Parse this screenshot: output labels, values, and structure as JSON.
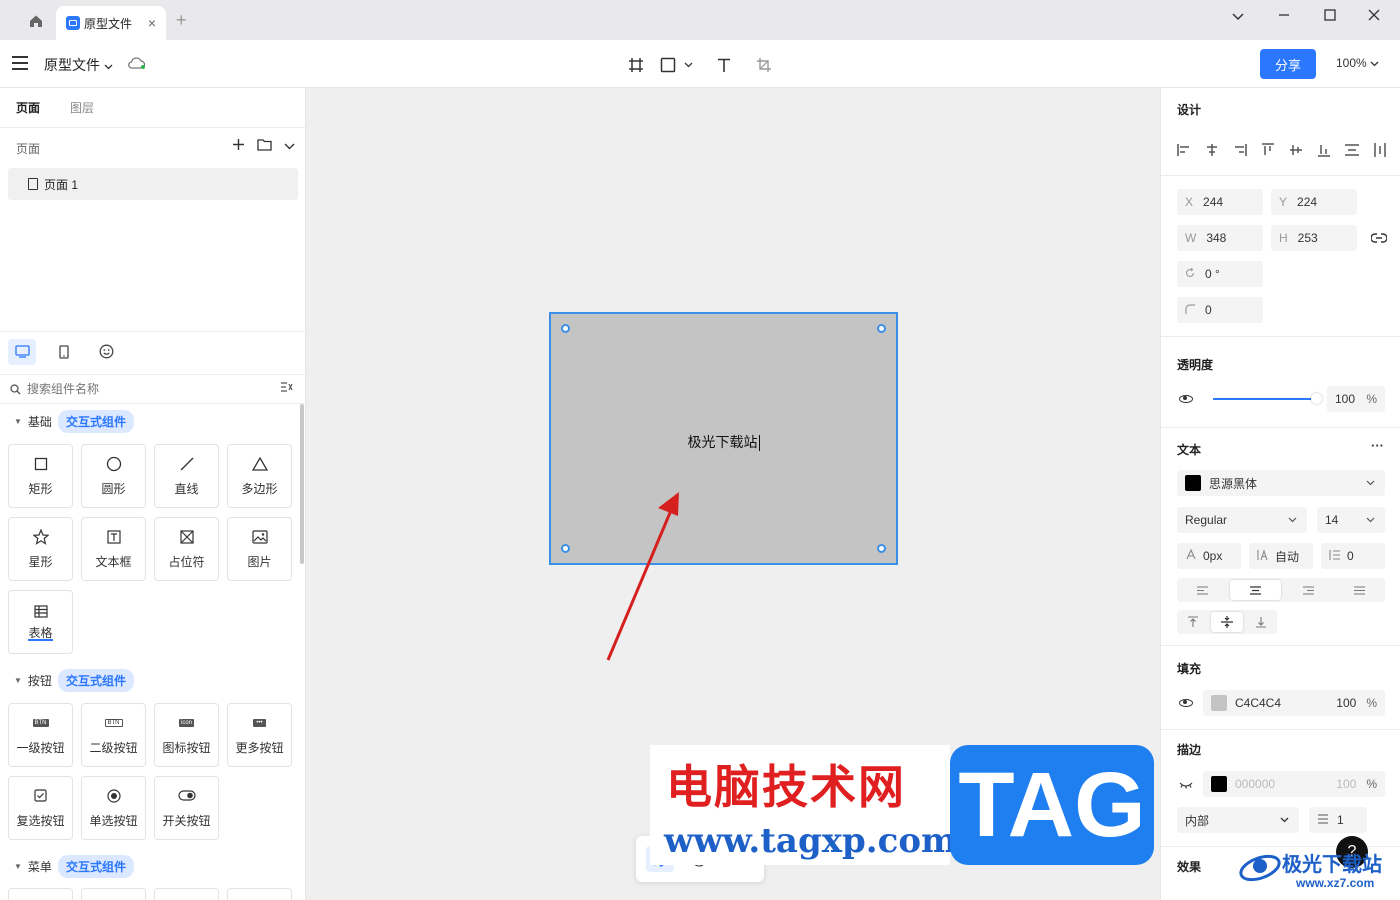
{
  "tabbar": {
    "tab_title": "原型文件",
    "new_tab": "+",
    "close": "×"
  },
  "toolbar": {
    "file_name": "原型文件",
    "share": "分享",
    "zoom": "100%"
  },
  "left": {
    "tabs": [
      "页面",
      "图层"
    ],
    "pages_header": "页面",
    "page_item": "页面 1",
    "search_placeholder": "搜索组件名称",
    "sections": [
      {
        "title": "基础",
        "badge": "交互式组件"
      },
      {
        "title": "按钮",
        "badge": "交互式组件"
      },
      {
        "title": "菜单",
        "badge": "交互式组件"
      }
    ],
    "basic_components": [
      "矩形",
      "圆形",
      "直线",
      "多边形",
      "星形",
      "文本框",
      "占位符",
      "图片",
      "表格"
    ],
    "button_components": [
      "一级按钮",
      "二级按钮",
      "图标按钮",
      "更多按钮",
      "复选按钮",
      "单选按钮",
      "开关按钮"
    ],
    "button_icon_labels": [
      "BTN",
      "BTN",
      "icon",
      "•••"
    ]
  },
  "canvas": {
    "rect_text": "极光下载站"
  },
  "right": {
    "design_title": "设计",
    "x_label": "X",
    "x": "244",
    "y_label": "Y",
    "y": "224",
    "w_label": "W",
    "w": "348",
    "h_label": "H",
    "h": "253",
    "rotation": "0 °",
    "radius": "0",
    "opacity_title": "透明度",
    "opacity": "100",
    "percent": "%",
    "text_title": "文本",
    "more": "···",
    "font_family": "思源黑体",
    "font_weight": "Regular",
    "font_size": "14",
    "letter_spacing": "0px",
    "line_height": "自动",
    "paragraph": "0",
    "fill_title": "填充",
    "fill_color": "C4C4C4",
    "fill_opacity": "100",
    "stroke_title": "描边",
    "stroke_color": "000000",
    "stroke_opacity": "100",
    "stroke_position": "内部",
    "stroke_width": "1",
    "effect_title": "效果"
  },
  "watermark": {
    "cn": "电脑技术网",
    "url": "www.tagxp.com",
    "tag": "TAG",
    "site_cn": "极光下载站",
    "site_url": "www.xz7.com"
  },
  "help": "?",
  "colors": {
    "accent": "#2b78ff",
    "fill": "#C4C4C4",
    "selection": "#3b8fe6",
    "annotation_arrow": "#d62020"
  }
}
